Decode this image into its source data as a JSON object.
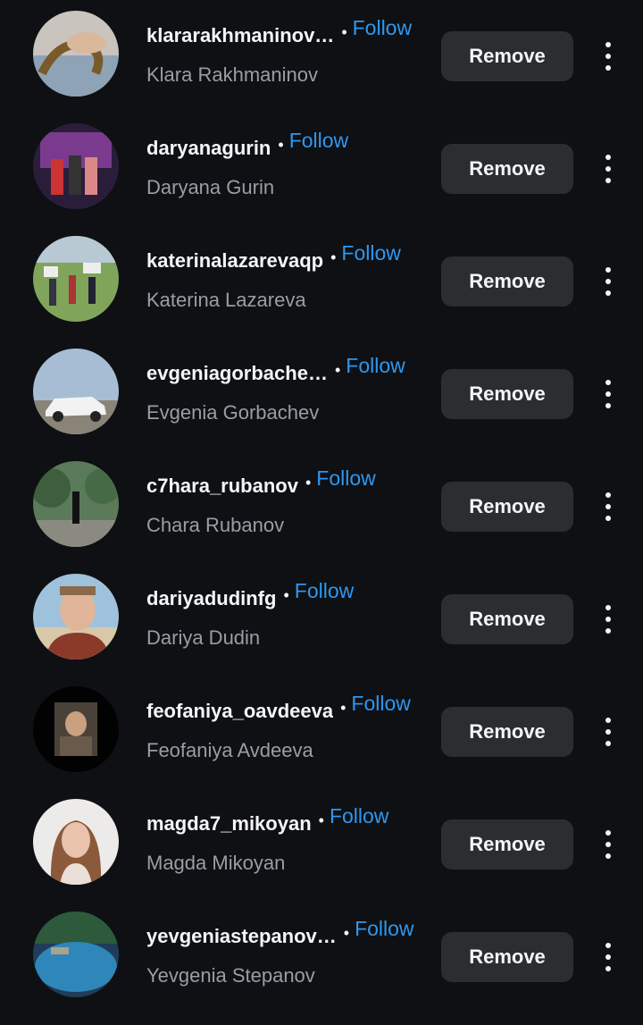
{
  "followers": [
    {
      "username": "klararakhmaninov…",
      "name": "Klara Rakhmaninov",
      "follow_label": "Follow",
      "remove_label": "Remove",
      "avatar": "hand-with-snake-photo"
    },
    {
      "username": "daryanagurin",
      "name": "Daryana Gurin",
      "follow_label": "Follow",
      "remove_label": "Remove",
      "avatar": "group-on-stage-photo"
    },
    {
      "username": "katerinalazarevaqp",
      "name": "Katerina Lazareva",
      "follow_label": "Follow",
      "remove_label": "Remove",
      "avatar": "group-with-signs-photo"
    },
    {
      "username": "evgeniagorbache…",
      "name": "Evgenia Gorbachev",
      "follow_label": "Follow",
      "remove_label": "Remove",
      "avatar": "white-car-photo"
    },
    {
      "username": "c7hara_rubanov",
      "name": "Chara Rubanov",
      "follow_label": "Follow",
      "remove_label": "Remove",
      "avatar": "person-in-park-photo"
    },
    {
      "username": "dariyadudinfg",
      "name": "Dariya Dudin",
      "follow_label": "Follow",
      "remove_label": "Remove",
      "avatar": "man-portrait-photo"
    },
    {
      "username": "feofaniya_oavdeeva",
      "name": "Feofaniya Avdeeva",
      "follow_label": "Follow",
      "remove_label": "Remove",
      "avatar": "dark-portrait-photo"
    },
    {
      "username": "magda7_mikoyan",
      "name": "Magda Mikoyan",
      "follow_label": "Follow",
      "remove_label": "Remove",
      "avatar": "woman-portrait-photo"
    },
    {
      "username": "yevgeniastepanov…",
      "name": "Yevgenia Stepanov",
      "follow_label": "Follow",
      "remove_label": "Remove",
      "avatar": "blue-lake-photo"
    }
  ],
  "colors": {
    "background": "#0e1013",
    "follow_link": "#2f97f0",
    "button_bg": "#2b2d31",
    "secondary_text": "#9a9da3"
  }
}
